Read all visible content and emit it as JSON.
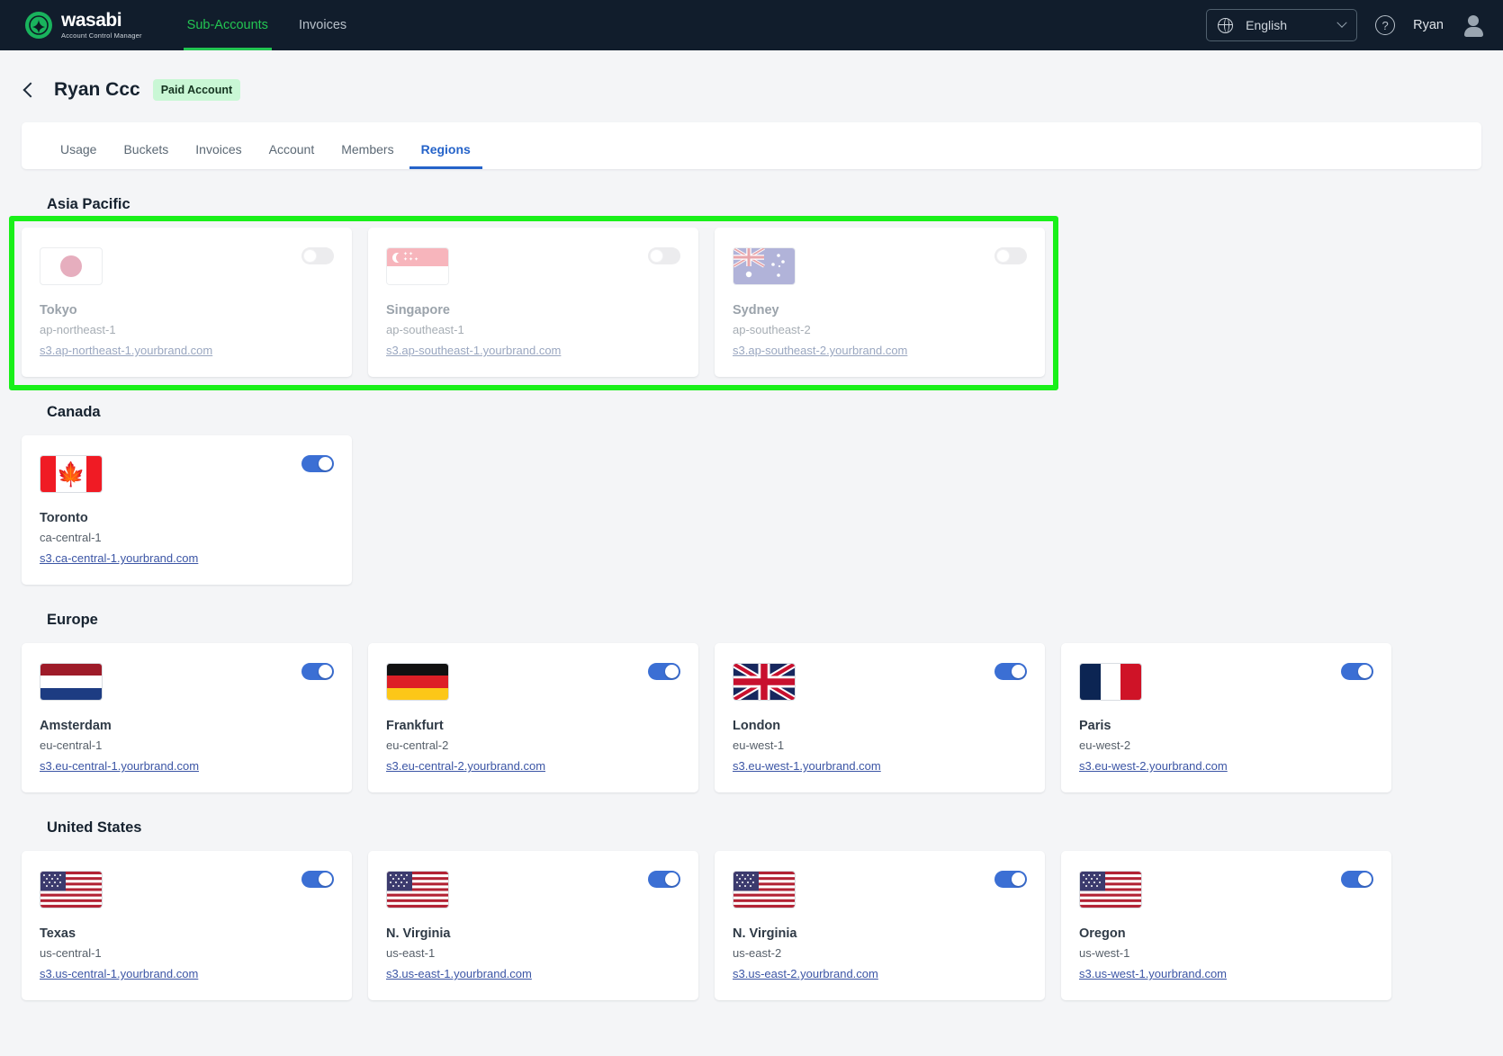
{
  "topnav": {
    "brand_name": "wasabi",
    "brand_tagline": "Account Control Manager",
    "links": [
      {
        "label": "Sub-Accounts",
        "active": true
      },
      {
        "label": "Invoices",
        "active": false
      }
    ],
    "language": "English",
    "user_name": "Ryan"
  },
  "page_header": {
    "account_name": "Ryan Ccc",
    "badge": "Paid Account"
  },
  "tabs": [
    {
      "label": "Usage",
      "active": false
    },
    {
      "label": "Buckets",
      "active": false
    },
    {
      "label": "Invoices",
      "active": false
    },
    {
      "label": "Account",
      "active": false
    },
    {
      "label": "Members",
      "active": false
    },
    {
      "label": "Regions",
      "active": true
    }
  ],
  "colors": {
    "nav_background": "#111d2c",
    "brand_green": "#23c552",
    "tab_active": "#2563c9",
    "toggle_on": "#3b6fd4",
    "toggle_off": "#ececee",
    "highlight_border": "#19f019",
    "badge_background": "#c9f7d5",
    "link": "#3b55a5"
  },
  "sections": [
    {
      "title": "Asia Pacific",
      "highlighted": true,
      "regions": [
        {
          "city": "Tokyo",
          "code": "ap-northeast-1",
          "url": "s3.ap-northeast-1.yourbrand.com",
          "enabled": false,
          "dimmed": true,
          "flag": "japan-flag"
        },
        {
          "city": "Singapore",
          "code": "ap-southeast-1",
          "url": "s3.ap-southeast-1.yourbrand.com",
          "enabled": false,
          "dimmed": true,
          "flag": "singapore-flag"
        },
        {
          "city": "Sydney",
          "code": "ap-southeast-2",
          "url": "s3.ap-southeast-2.yourbrand.com",
          "enabled": false,
          "dimmed": true,
          "flag": "australia-flag"
        }
      ]
    },
    {
      "title": "Canada",
      "highlighted": false,
      "regions": [
        {
          "city": "Toronto",
          "code": "ca-central-1",
          "url": "s3.ca-central-1.yourbrand.com",
          "enabled": true,
          "dimmed": false,
          "flag": "canada-flag"
        }
      ]
    },
    {
      "title": "Europe",
      "highlighted": false,
      "regions": [
        {
          "city": "Amsterdam",
          "code": "eu-central-1",
          "url": "s3.eu-central-1.yourbrand.com",
          "enabled": true,
          "dimmed": false,
          "flag": "netherlands-flag"
        },
        {
          "city": "Frankfurt",
          "code": "eu-central-2",
          "url": "s3.eu-central-2.yourbrand.com",
          "enabled": true,
          "dimmed": false,
          "flag": "germany-flag"
        },
        {
          "city": "London",
          "code": "eu-west-1",
          "url": "s3.eu-west-1.yourbrand.com",
          "enabled": true,
          "dimmed": false,
          "flag": "united-kingdom-flag"
        },
        {
          "city": "Paris",
          "code": "eu-west-2",
          "url": "s3.eu-west-2.yourbrand.com",
          "enabled": true,
          "dimmed": false,
          "flag": "france-flag"
        }
      ]
    },
    {
      "title": "United States",
      "highlighted": false,
      "regions": [
        {
          "city": "Texas",
          "code": "us-central-1",
          "url": "s3.us-central-1.yourbrand.com",
          "enabled": true,
          "dimmed": false,
          "flag": "united-states-flag"
        },
        {
          "city": "N. Virginia",
          "code": "us-east-1",
          "url": "s3.us-east-1.yourbrand.com",
          "enabled": true,
          "dimmed": false,
          "flag": "united-states-flag"
        },
        {
          "city": "N. Virginia",
          "code": "us-east-2",
          "url": "s3.us-east-2.yourbrand.com",
          "enabled": true,
          "dimmed": false,
          "flag": "united-states-flag"
        },
        {
          "city": "Oregon",
          "code": "us-west-1",
          "url": "s3.us-west-1.yourbrand.com",
          "enabled": true,
          "dimmed": false,
          "flag": "united-states-flag"
        }
      ]
    }
  ]
}
